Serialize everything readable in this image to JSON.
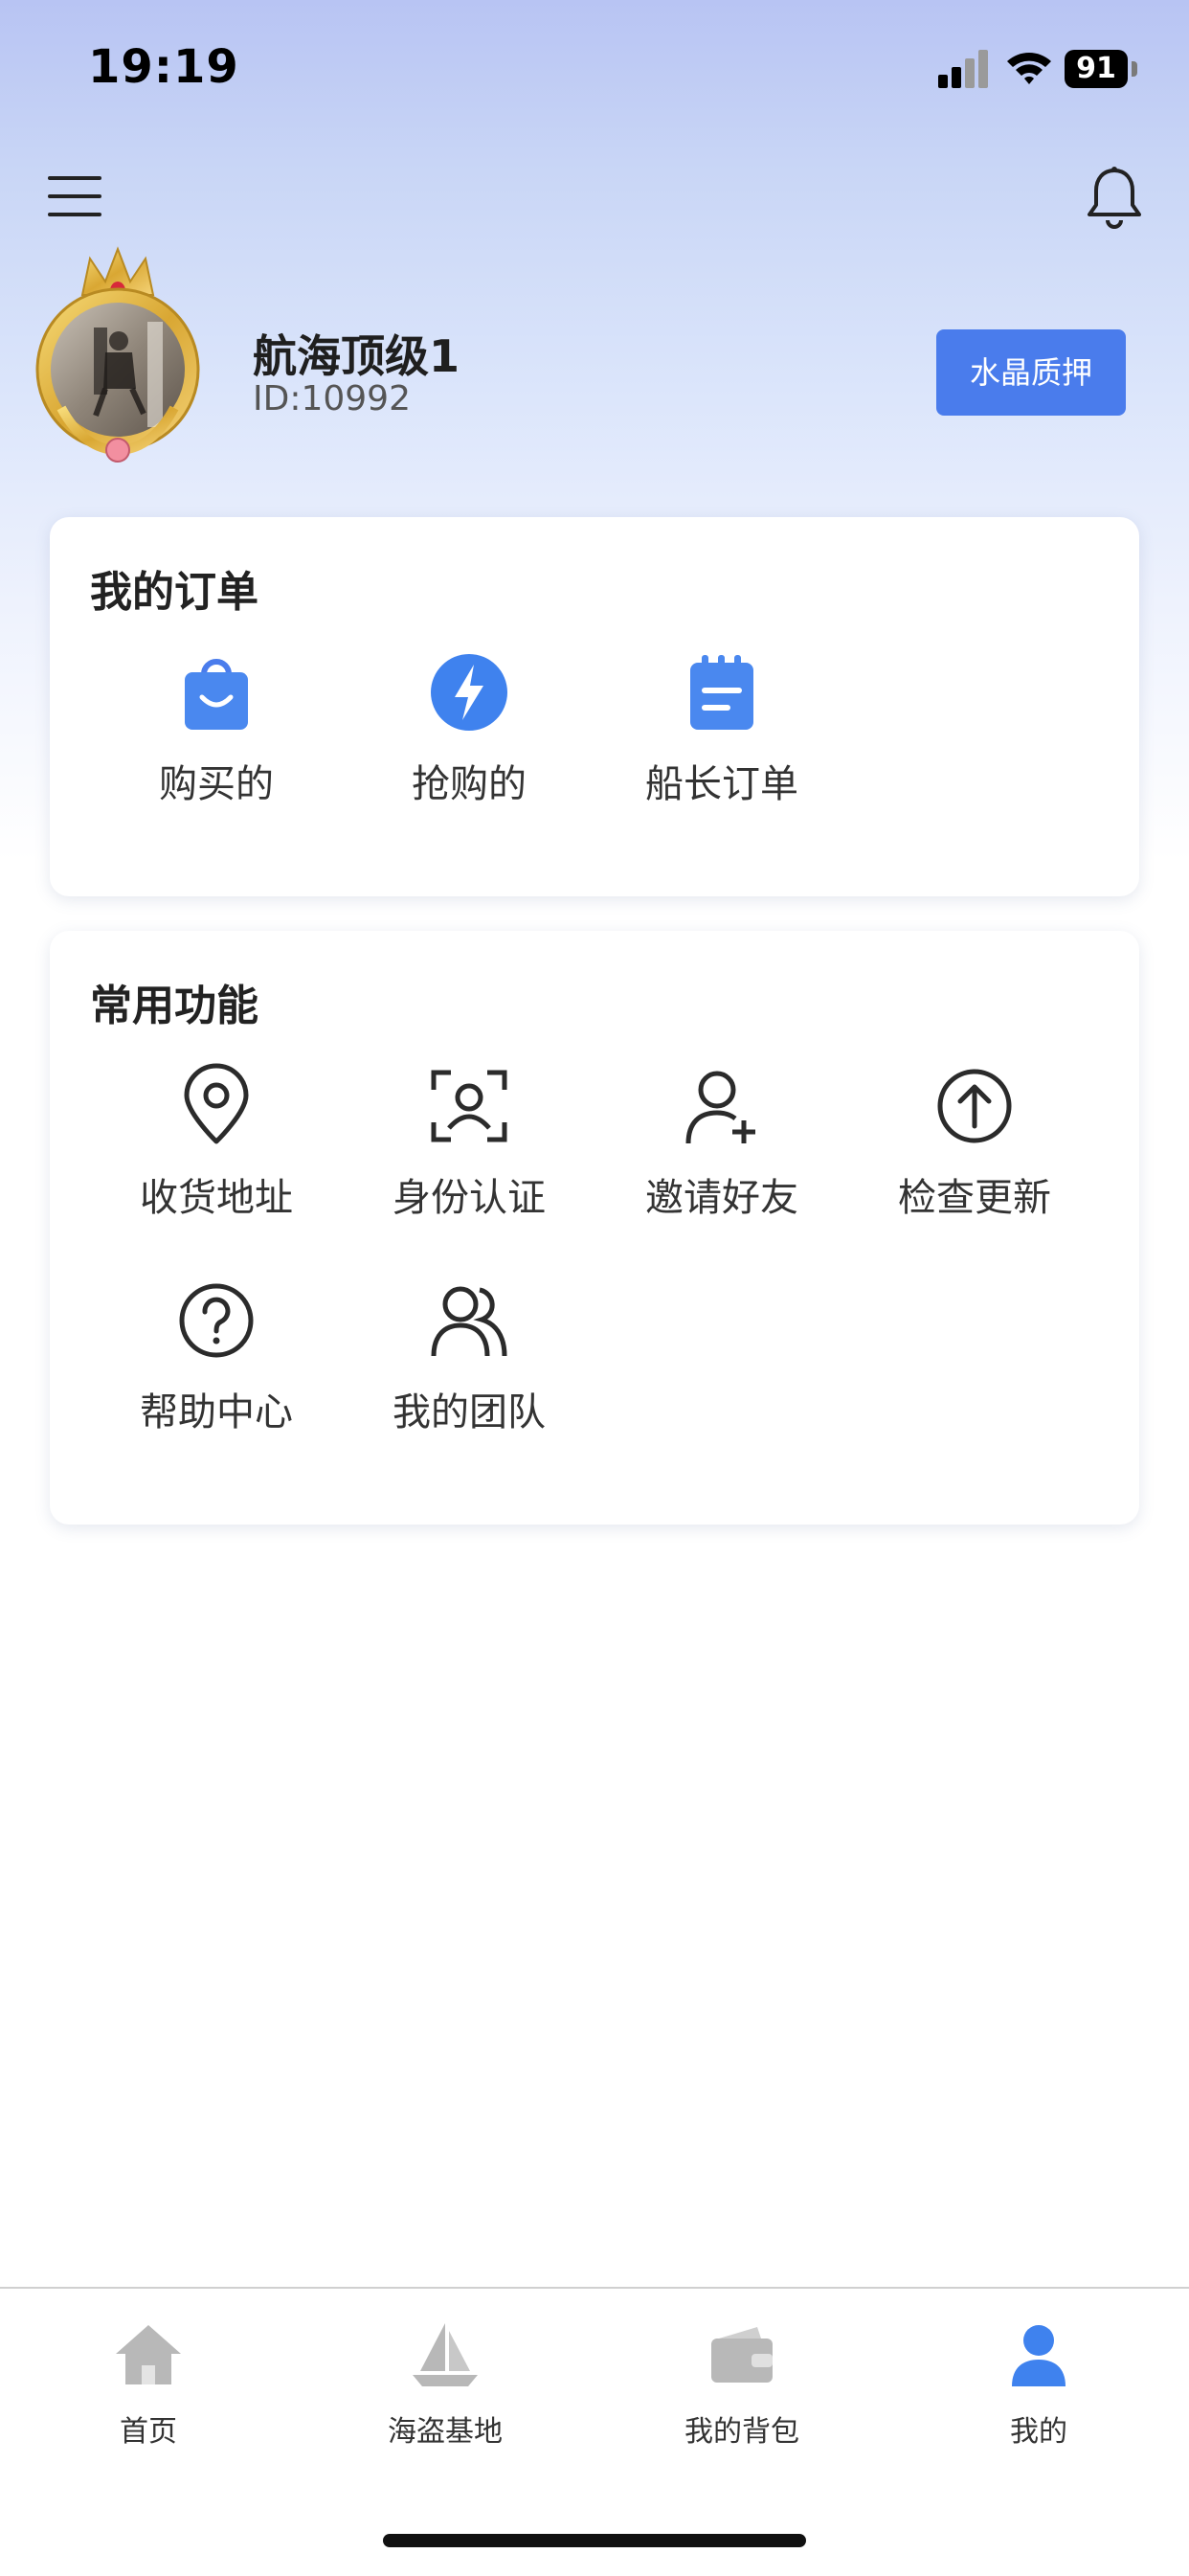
{
  "status_bar": {
    "time": "19:19",
    "battery": "91"
  },
  "profile": {
    "name": "航海顶级1",
    "id": "ID:10992",
    "pledge_button": "水晶质押"
  },
  "orders": {
    "title": "我的订单",
    "items": [
      {
        "label": "购买的",
        "icon": "shopping-bag-icon"
      },
      {
        "label": "抢购的",
        "icon": "lightning-icon"
      },
      {
        "label": "船长订单",
        "icon": "notepad-icon"
      }
    ]
  },
  "functions": {
    "title": "常用功能",
    "items": [
      {
        "label": "收货地址",
        "icon": "location-pin-icon"
      },
      {
        "label": "身份认证",
        "icon": "face-scan-icon"
      },
      {
        "label": "邀请好友",
        "icon": "add-user-icon"
      },
      {
        "label": "检查更新",
        "icon": "upload-arrow-icon"
      },
      {
        "label": "帮助中心",
        "icon": "help-icon"
      },
      {
        "label": "我的团队",
        "icon": "team-icon"
      }
    ]
  },
  "bottom_nav": {
    "items": [
      {
        "label": "首页",
        "icon": "home-icon"
      },
      {
        "label": "海盗基地",
        "icon": "sailboat-icon"
      },
      {
        "label": "我的背包",
        "icon": "wallet-icon"
      },
      {
        "label": "我的",
        "icon": "user-icon",
        "active": true
      }
    ]
  },
  "colors": {
    "accent": "#4a7cec",
    "icon_dark": "#2b2b2b",
    "nav_inactive": "#b8b8b8"
  }
}
